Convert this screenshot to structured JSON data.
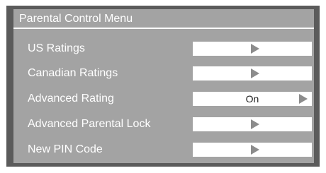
{
  "menu": {
    "title": "Parental Control Menu",
    "items": [
      {
        "label": "US Ratings",
        "value": ""
      },
      {
        "label": "Canadian Ratings",
        "value": ""
      },
      {
        "label": "Advanced Rating",
        "value": "On"
      },
      {
        "label": "Advanced Parental Lock",
        "value": ""
      },
      {
        "label": "New PIN Code",
        "value": ""
      }
    ]
  },
  "icons": {
    "submenu": "arrow-right-icon"
  },
  "colors": {
    "frame": "#5b5b5b",
    "panel": "#a3a3a3",
    "text": "#ffffff",
    "value_box": "#ffffff",
    "arrow": "#8c8c8c"
  }
}
